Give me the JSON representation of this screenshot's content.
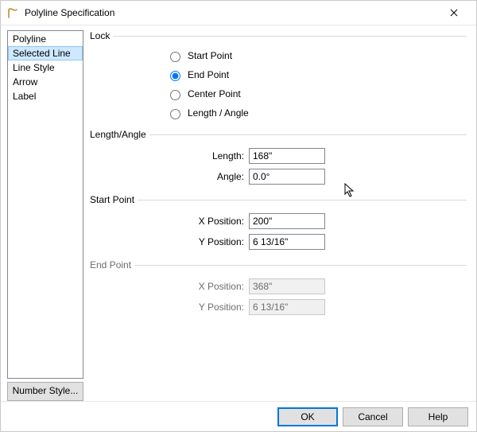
{
  "window": {
    "title": "Polyline Specification"
  },
  "sidebar": {
    "items": [
      {
        "label": "Polyline"
      },
      {
        "label": "Selected Line"
      },
      {
        "label": "Line Style"
      },
      {
        "label": "Arrow"
      },
      {
        "label": "Label"
      }
    ],
    "selected_index": 1,
    "number_style_label": "Number Style..."
  },
  "groups": {
    "lock": {
      "legend": "Lock",
      "options": [
        {
          "label": "Start Point"
        },
        {
          "label": "End Point"
        },
        {
          "label": "Center Point"
        },
        {
          "label": "Length / Angle"
        }
      ],
      "selected_index": 1
    },
    "length_angle": {
      "legend": "Length/Angle",
      "length_label": "Length:",
      "length_value": "168\"",
      "angle_label": "Angle:",
      "angle_value": "0.0°"
    },
    "start_point": {
      "legend": "Start Point",
      "x_label": "X Position:",
      "x_value": "200\"",
      "y_label": "Y Position:",
      "y_value": "6 13/16\""
    },
    "end_point": {
      "legend": "End Point",
      "x_label": "X Position:",
      "x_value": "368\"",
      "y_label": "Y Position:",
      "y_value": "6 13/16\""
    }
  },
  "footer": {
    "ok": "OK",
    "cancel": "Cancel",
    "help": "Help"
  }
}
